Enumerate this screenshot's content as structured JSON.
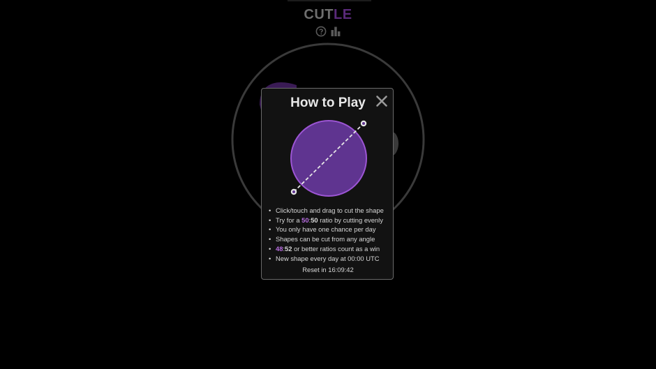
{
  "app": {
    "title_part1": "CUT",
    "title_part2": "LE",
    "help_icon": "question-circle-icon",
    "stats_icon": "bar-chart-icon"
  },
  "colors": {
    "background": "#000000",
    "accent_purple": "#b86de0",
    "shape_fill": "#5f3490",
    "shape_stroke": "#9c55d4"
  },
  "modal": {
    "title": "How to Play",
    "close_icon": "close-icon",
    "rules": [
      {
        "bullet": "•",
        "parts": [
          {
            "text": "Click/touch and drag to cut the shape",
            "style": "normal"
          }
        ]
      },
      {
        "bullet": "•",
        "parts": [
          {
            "text": "Try for a ",
            "style": "normal"
          },
          {
            "text": "50",
            "style": "accent"
          },
          {
            "text": ":",
            "style": "normal"
          },
          {
            "text": "50",
            "style": "bold"
          },
          {
            "text": " ratio by cutting evenly",
            "style": "normal"
          }
        ]
      },
      {
        "bullet": "•",
        "parts": [
          {
            "text": "You only have one chance per day",
            "style": "normal"
          }
        ]
      },
      {
        "bullet": "•",
        "parts": [
          {
            "text": "Shapes can be cut from any angle",
            "style": "normal"
          }
        ]
      },
      {
        "bullet": "•",
        "parts": [
          {
            "text": "48",
            "style": "accent"
          },
          {
            "text": ":",
            "style": "normal"
          },
          {
            "text": "52",
            "style": "bold"
          },
          {
            "text": " or better ratios count as a win",
            "style": "normal"
          }
        ]
      },
      {
        "bullet": "•",
        "parts": [
          {
            "text": "New shape every day at 00:00 UTC",
            "style": "normal"
          }
        ]
      }
    ],
    "reset_text": "Reset in 16:09:42"
  }
}
